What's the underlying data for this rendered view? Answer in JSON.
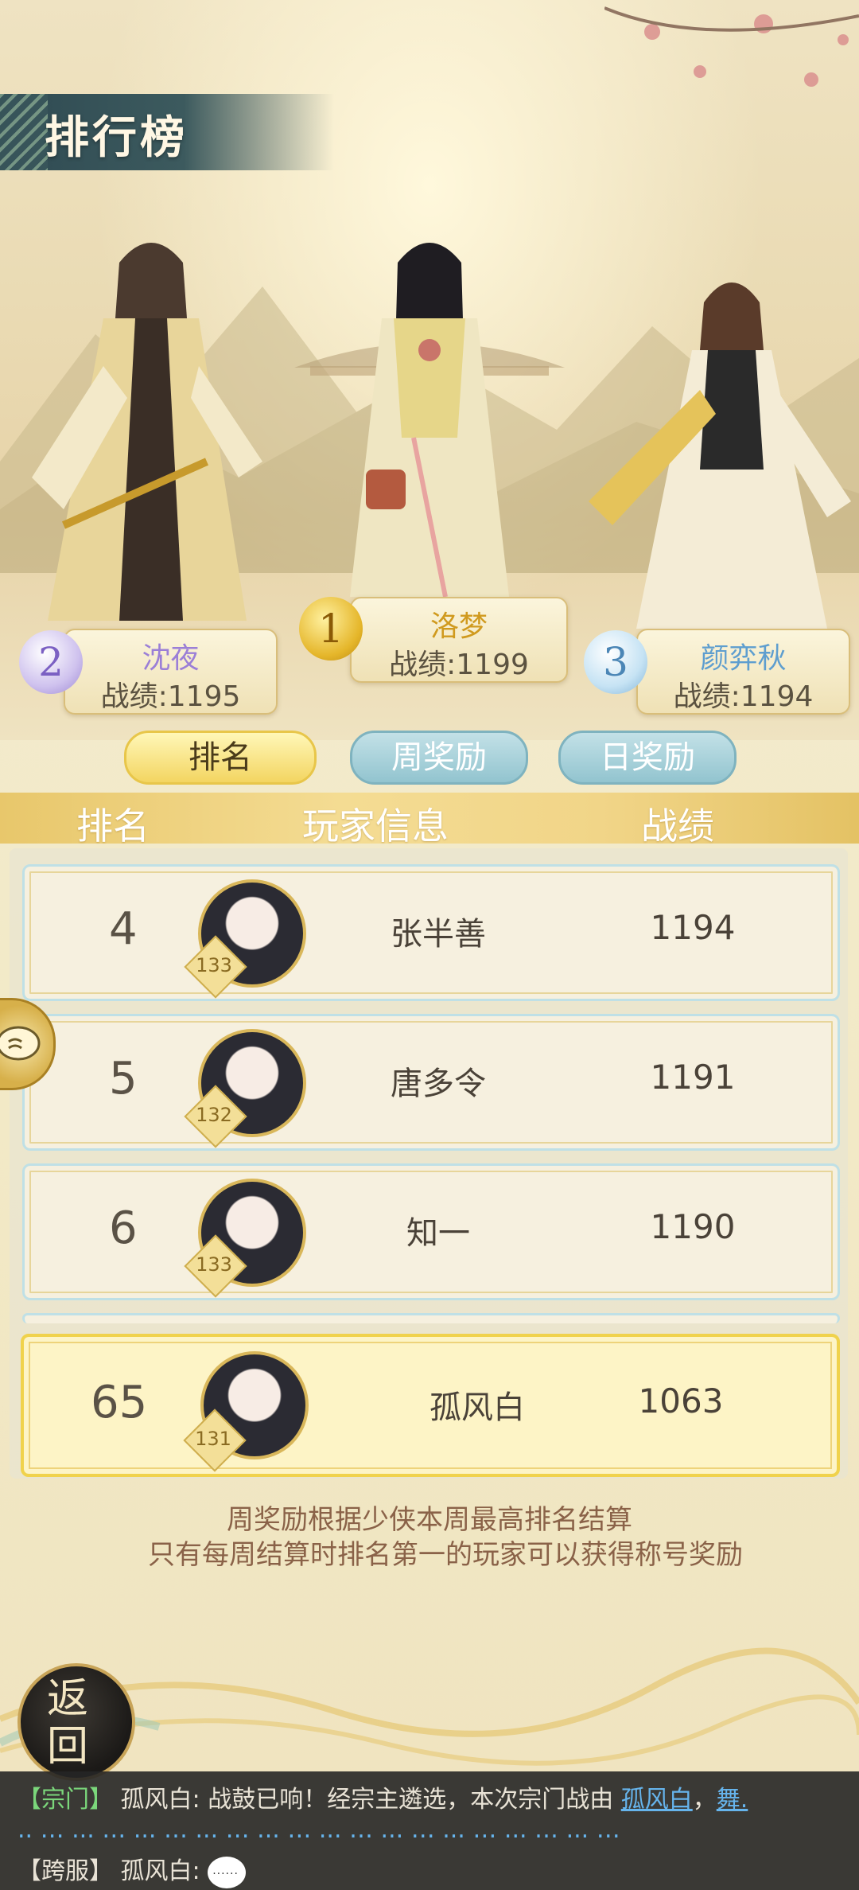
{
  "header": {
    "title": "排行榜"
  },
  "podium": [
    {
      "rank": "1",
      "name": "洛梦",
      "score": "战绩:1199",
      "name_color": "#d09a1e"
    },
    {
      "rank": "2",
      "name": "沈夜",
      "score": "战绩:1195",
      "name_color": "#9b7fd7"
    },
    {
      "rank": "3",
      "name": "颜弈秋",
      "score": "战绩:1194",
      "name_color": "#5e9ecf"
    }
  ],
  "tabs": [
    {
      "label": "排名",
      "active": true
    },
    {
      "label": "周奖励",
      "active": false
    },
    {
      "label": "日奖励",
      "active": false
    }
  ],
  "columns": {
    "rank": "排名",
    "player": "玩家信息",
    "score": "战绩"
  },
  "rows": [
    {
      "rank": "4",
      "level": "133",
      "name": "张半善",
      "score": "1194"
    },
    {
      "rank": "5",
      "level": "132",
      "name": "唐多令",
      "score": "1191"
    },
    {
      "rank": "6",
      "level": "133",
      "name": "知一",
      "score": "1190"
    }
  ],
  "my_row": {
    "rank": "65",
    "level": "131",
    "name": "孤风白",
    "score": "1063"
  },
  "notice": {
    "line1": "周奖励根据少侠本周最高排名结算",
    "line2": "只有每周结算时排名第一的玩家可以获得称号奖励"
  },
  "back_button": {
    "label": "返回"
  },
  "chat": {
    "line1_tag": "【宗门】",
    "line1_text": "孤风白: 战鼓已响！经宗主遴选，本次宗门战由",
    "line1_link1": "孤风白",
    "line1_comma": "，",
    "line1_link2": "舞.",
    "line2_text": ".. … ... … ... … ... … ... … ... … ... … ... … ... … ... …",
    "line3_tag": "【跨服】",
    "line3_text": "孤风白:",
    "line3_emoji": "......"
  },
  "colors": {
    "accent_gold": "#f0d24c",
    "tab_inactive": "#92c4cf",
    "chat_link": "#66b4ec",
    "chat_tag": "#7bd77b"
  }
}
